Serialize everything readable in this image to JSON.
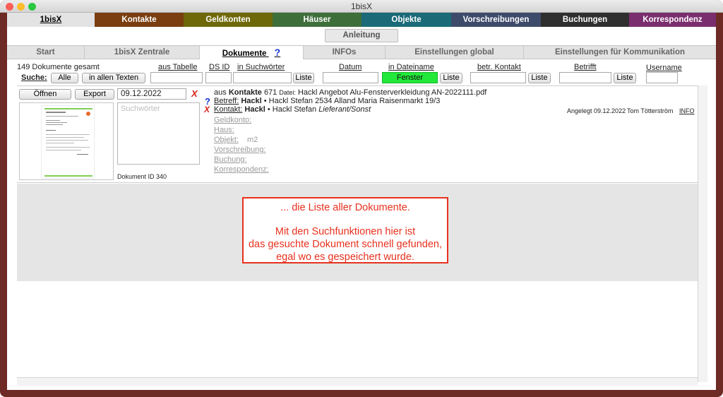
{
  "window": {
    "title": "1bisX"
  },
  "main_tabs": [
    {
      "label": "1bisX",
      "color": "#e3e3e3"
    },
    {
      "label": "Kontakte",
      "color": "#7a3e10"
    },
    {
      "label": "Geldkonten",
      "color": "#6e6808"
    },
    {
      "label": "Häuser",
      "color": "#3e6e3a"
    },
    {
      "label": "Objekte",
      "color": "#1a6a78"
    },
    {
      "label": "Vorschreibungen",
      "color": "#3e4a6a"
    },
    {
      "label": "Buchungen",
      "color": "#2f2f2f"
    },
    {
      "label": "Korrespondenz",
      "color": "#7a2e6e"
    }
  ],
  "anleitung": "Anleitung",
  "sub_tabs": [
    "Start",
    "1bisX Zentrale",
    "Dokumente",
    "INFOs",
    "Einstellungen global",
    "Einstellungen für Kommunikation"
  ],
  "search": {
    "total": "149 Dokumente gesamt",
    "suche": "Suche:",
    "alle": "Alle",
    "in_allen": "in allen Texten",
    "aus_tabelle": "aus Tabelle",
    "ds_id": "DS ID",
    "in_suchwoertern": "in Suchwörter",
    "liste": "Liste",
    "datum": "Datum",
    "in_dateiname": "in Dateiname",
    "fenster": "Fenster",
    "betr_kontakt": "betr. Kontakt",
    "betrifft": "Betrifft",
    "username": "Username"
  },
  "record": {
    "oeffnen": "Öffnen",
    "export": "Export",
    "date": "09.12.2022",
    "suchwoerter_placeholder": "Suchwörter",
    "doc_id": "Dokument ID 340",
    "aus": "aus",
    "kontakte": "Kontakte",
    "kontakt_nr": "671",
    "datei_label": "Datei:",
    "datei_name": "Hackl Angebot Alu-Fensterverkleidung AN-2022111.pdf",
    "betreff_label": "Betreff:",
    "betreff_name": "Hackl",
    "betreff_rest": "• Hackl Stefan 2534 Alland Maria Raisenmarkt 19/3",
    "kontakt_label": "Kontakt:",
    "kontakt_name": "Hackl",
    "kontakt_rest": "• Hackl Stefan",
    "kontakt_role": "Lieferant/Sonst",
    "geldkonto": "Geldkonto:",
    "haus": "Haus:",
    "objekt": "Objekt:",
    "objekt_val": "m2",
    "vorschreibung": "Vorschreibung:",
    "buchung": "Buchung:",
    "korrespondenz": "Korrespondenz:",
    "angelegt": "Angelegt 09.12.2022",
    "user": "Tom Tötterström",
    "info": "INFO"
  },
  "callout": {
    "line1": "... die Liste aller Dokumente.",
    "line2": "Mit den Suchfunktionen hier ist",
    "line3": "das gesuchte Dokument schnell gefunden,",
    "line4": "egal wo es gespeichert wurde."
  },
  "colors": {
    "frame": "#6e2a24",
    "fenster": "#22e83a",
    "callout_border": "#e8311e"
  }
}
